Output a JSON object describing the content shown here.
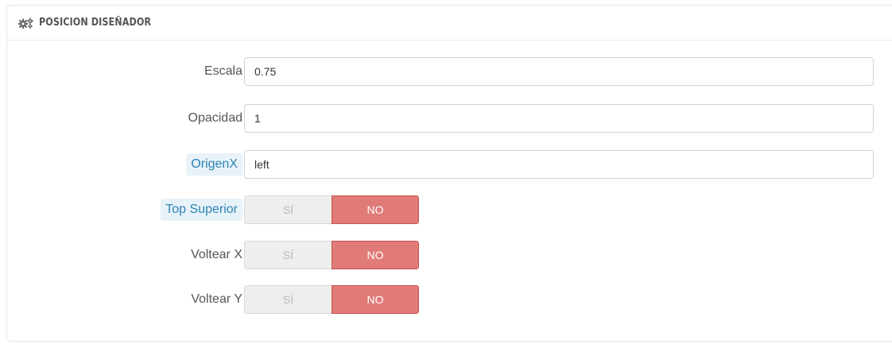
{
  "panel": {
    "title": "POSICION DISEÑADOR",
    "icon": "cogs-icon"
  },
  "fields": {
    "escala": {
      "label": "Escala",
      "value": "0.75"
    },
    "opacidad": {
      "label": "Opacidad",
      "value": "1"
    },
    "origenx": {
      "label": "OrigenX",
      "value": "left"
    }
  },
  "toggles": {
    "top_superior": {
      "label": "Top Superior",
      "yes": "SÍ",
      "no": "NO",
      "selected": "NO"
    },
    "voltear_x": {
      "label": "Voltear X",
      "yes": "SÍ",
      "no": "NO",
      "selected": "NO"
    },
    "voltear_y": {
      "label": "Voltear Y",
      "yes": "SÍ",
      "no": "NO",
      "selected": "NO"
    }
  },
  "colors": {
    "accent_no": "#e07b78",
    "hint_label": "#2b84b2"
  }
}
